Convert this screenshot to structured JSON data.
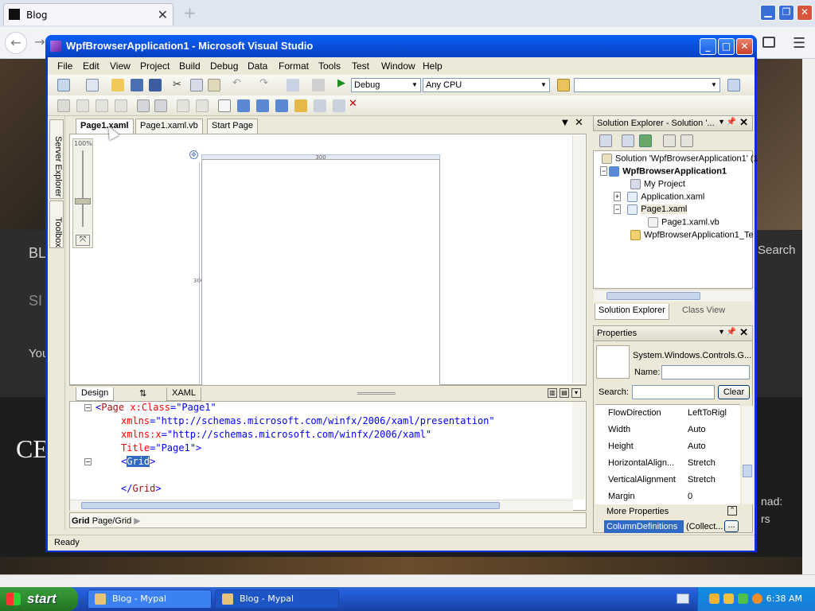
{
  "browser": {
    "tab_title": "Blog",
    "tab_close": "✕",
    "new_tab": "+",
    "back": "←",
    "forward": "→"
  },
  "webpage": {
    "nav_blog": "BL",
    "nav_sign": "SI",
    "search": "Search",
    "you": "You",
    "heading": "CE",
    "side_text1": "nad:",
    "side_text2": "rs"
  },
  "vs": {
    "title": "WpfBrowserApplication1 - Microsoft Visual Studio",
    "menu": [
      "File",
      "Edit",
      "View",
      "Project",
      "Build",
      "Debug",
      "Data",
      "Format",
      "Tools",
      "Test",
      "Window",
      "Help"
    ],
    "config_combo": "Debug",
    "platform_combo": "Any CPU",
    "find_combo": "",
    "side_tabs": {
      "server_explorer": "Server Explorer",
      "toolbox": "Toolbox"
    },
    "doc_tabs": [
      "Page1.xaml",
      "Page1.xaml.vb",
      "Start Page"
    ],
    "zoom_label": "100%",
    "ruler_width": "300",
    "ruler_height": "300",
    "split_tabs": {
      "design": "Design",
      "swap": "⇅",
      "xaml": "XAML"
    },
    "code": {
      "l1_open": "<",
      "l1_tag": "Page",
      "l1_attr": "x:Class",
      "l1_val": "\"Page1\"",
      "l2_attr": "xmlns",
      "l2_val": "\"http://schemas.microsoft.com/winfx/2006/xaml/presentation\"",
      "l3_attr": "xmlns:x",
      "l3_val": "\"http://schemas.microsoft.com/winfx/2006/xaml\"",
      "l4_attr": "Title",
      "l4_val": "\"Page1\">",
      "l5_open": "<",
      "l5_tag": "Grid",
      "l5_close": ">",
      "l6_open": "</",
      "l6_tag": "Grid",
      "l6_close": ">"
    },
    "breadcrumb_bold": "Grid",
    "breadcrumb_path": "Page/Grid",
    "status": "Ready"
  },
  "solution_explorer": {
    "header": "Solution Explorer - Solution '...",
    "items": [
      "Solution 'WpfBrowserApplication1' (1",
      "WpfBrowserApplication1",
      "My Project",
      "Application.xaml",
      "Page1.xaml",
      "Page1.xaml.vb",
      "WpfBrowserApplication1_Te"
    ],
    "bottom_tabs": [
      "Solution Explorer",
      "Class View"
    ]
  },
  "properties": {
    "header": "Properties",
    "type": "System.Windows.Controls.G...",
    "name_label": "Name:",
    "name_value": "",
    "search_label": "Search:",
    "search_value": "",
    "clear_button": "Clear",
    "rows": [
      {
        "name": "FlowDirection",
        "value": "LeftToRigl"
      },
      {
        "name": "Width",
        "value": "Auto"
      },
      {
        "name": "Height",
        "value": "Auto"
      },
      {
        "name": "HorizontalAlign...",
        "value": "Stretch"
      },
      {
        "name": "VerticalAlignment",
        "value": "Stretch"
      },
      {
        "name": "Margin",
        "value": "0"
      }
    ],
    "more_properties": "More Properties",
    "column_definitions": "ColumnDefinitions",
    "column_definitions_value": "(Collect...",
    "ellipsis": "..."
  },
  "taskbar": {
    "start": "start",
    "buttons": [
      "Blog - Mypal",
      "Blog - Mypal"
    ],
    "clock": "6:38 AM"
  },
  "colors": {
    "xp_blue": "#0a53e1",
    "selection": "#316ac5",
    "tag_color": "#a31515",
    "attr_color": "#ff0000",
    "value_color": "#0000ff"
  }
}
